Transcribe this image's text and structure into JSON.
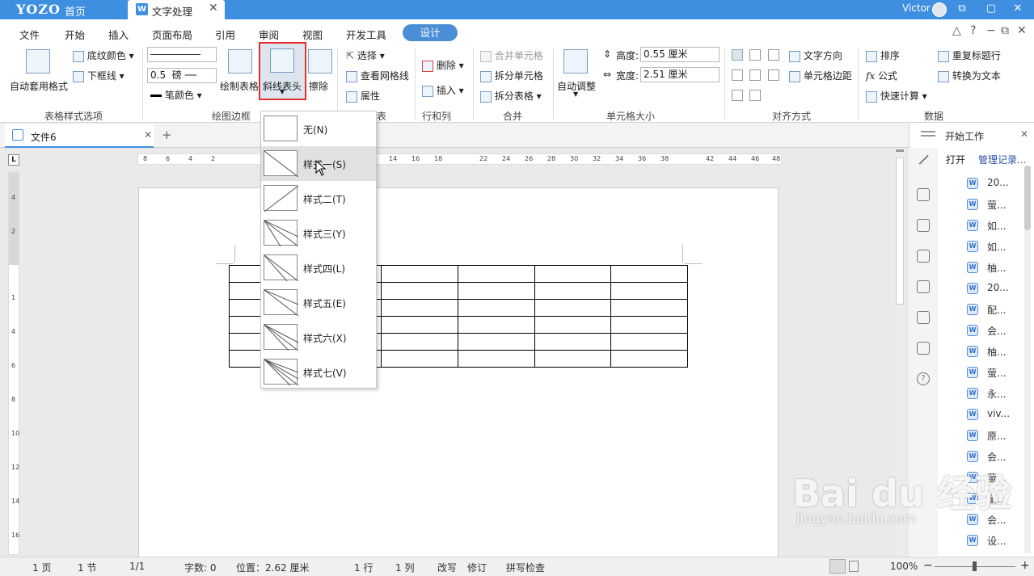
{
  "titlebar": {
    "logo": "YOZO",
    "home": "首页",
    "tab": "文字处理",
    "tab_icon": "W",
    "user": "Victor",
    "colors": {
      "bar": "#3e8fe0"
    }
  },
  "menu": {
    "items": [
      "文件",
      "开始",
      "插入",
      "页面布局",
      "引用",
      "审阅",
      "视图",
      "开发工具"
    ],
    "active": "设计"
  },
  "ribbon": {
    "auto_format": "自动套用格式",
    "shading": "底纹颜色",
    "bottom_border": "下框线",
    "group1": "表格样式选项",
    "line_width": "0.5",
    "line_unit": "磅",
    "pen_color": "笔颜色",
    "draw_table": "绘制表格",
    "diagonal": "斜线表头",
    "erase": "擦除",
    "group2": "绘图边框",
    "select": "选择",
    "view_grid": "查看网格线",
    "properties": "属性",
    "group3_tail": "表",
    "delete": "删除",
    "insert": "插入",
    "group4": "行和列",
    "merge_cells": "合并单元格",
    "split_cells": "拆分单元格",
    "split_table": "拆分表格",
    "group5": "合并",
    "auto_fit": "自动调整",
    "height_label": "高度:",
    "height_value": "0.55 厘米",
    "width_label": "宽度:",
    "width_value": "2.51 厘米",
    "group6": "单元格大小",
    "text_dir": "文字方向",
    "cell_margin": "单元格边距",
    "group7": "对齐方式",
    "sort": "排序",
    "formula": "公式",
    "quick_calc": "快速计算",
    "repeat_header": "重复标题行",
    "to_text": "转换为文本",
    "group8": "数据"
  },
  "doc": {
    "tab": "文件6",
    "add": "+"
  },
  "ruler": {
    "h": [
      "8",
      "6",
      "4",
      "2",
      "14",
      "16",
      "18",
      "22",
      "24",
      "26",
      "28",
      "30",
      "32",
      "34",
      "36",
      "38",
      "42",
      "44",
      "46",
      "48"
    ],
    "v": [
      "4",
      "2",
      "1",
      "4",
      "6",
      "8",
      "10",
      "12",
      "14",
      "16"
    ],
    "corner": "L"
  },
  "dropdown": {
    "items": [
      {
        "label": "无(N)"
      },
      {
        "label": "样式一(S)"
      },
      {
        "label": "样式二(T)"
      },
      {
        "label": "样式三(Y)"
      },
      {
        "label": "样式四(L)"
      },
      {
        "label": "样式五(E)"
      },
      {
        "label": "样式六(X)"
      },
      {
        "label": "样式七(V)"
      }
    ]
  },
  "sidepanel": {
    "title": "开始工作",
    "open": "打开",
    "manage": "管理记录...",
    "files": [
      "20...",
      "萤...",
      "如...",
      "如...",
      "柚...",
      "20...",
      "配...",
      "会...",
      "柚...",
      "萤...",
      "永...",
      "viv...",
      "原...",
      "会...",
      "萤...",
      "萤...",
      "会...",
      "设..."
    ]
  },
  "status": {
    "page": "1 页",
    "section": "1 节",
    "pages": "1/1",
    "words": "字数: 0",
    "position": "位置：2.62 厘米",
    "row": "1 行",
    "col": "1 列",
    "overwrite": "改写",
    "revise": "修订",
    "spell": "拼写检查",
    "zoom": "100%"
  },
  "watermark": {
    "main": "Bai du 经验",
    "sub": "jingyan.baidu.com"
  }
}
